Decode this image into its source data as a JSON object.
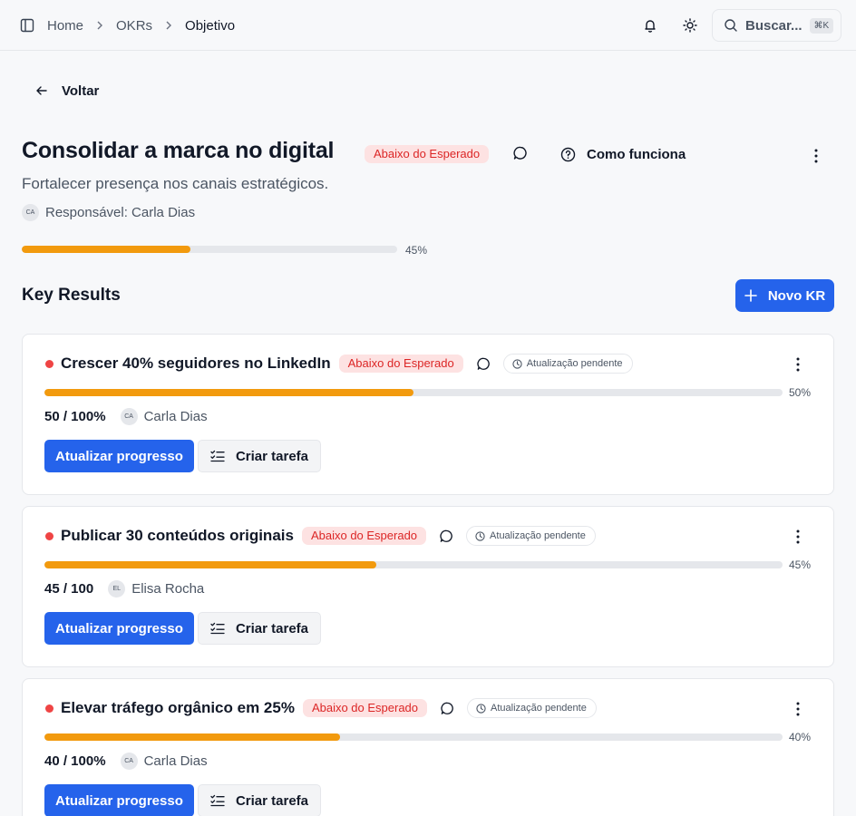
{
  "breadcrumb": {
    "home": "Home",
    "okrs": "OKRs",
    "current": "Objetivo"
  },
  "search": {
    "label": "Buscar...",
    "shortcut": "⌘K"
  },
  "back_label": "Voltar",
  "objective": {
    "title": "Consolidar a marca no digital",
    "status": "Abaixo do Esperado",
    "how_it_works": "Como funciona",
    "subtitle": "Fortalecer presença nos canais estratégicos.",
    "owner_initials": "CA",
    "owner_label": "Responsável: Carla Dias",
    "progress": 45,
    "progress_label": "45%"
  },
  "key_results_heading": "Key Results",
  "new_kr_label": "Novo KR",
  "key_results": [
    {
      "title": "Crescer 40% seguidores no LinkedIn",
      "status": "Abaixo do Esperado",
      "pending_label": "Atualização pendente",
      "progress": 50,
      "progress_label": "50%",
      "value": "50 / 100%",
      "owner_initials": "CA",
      "owner": "Carla Dias",
      "update_label": "Atualizar progresso",
      "task_label": "Criar tarefa"
    },
    {
      "title": "Publicar 30 conteúdos originais",
      "status": "Abaixo do Esperado",
      "pending_label": "Atualização pendente",
      "progress": 45,
      "progress_label": "45%",
      "value": "45 / 100",
      "owner_initials": "EL",
      "owner": "Elisa Rocha",
      "update_label": "Atualizar progresso",
      "task_label": "Criar tarefa"
    },
    {
      "title": "Elevar tráfego orgânico em 25%",
      "status": "Abaixo do Esperado",
      "pending_label": "Atualização pendente",
      "progress": 40,
      "progress_label": "40%",
      "value": "40 / 100%",
      "owner_initials": "CA",
      "owner": "Carla Dias",
      "update_label": "Atualizar progresso",
      "task_label": "Criar tarefa"
    }
  ],
  "colors": {
    "accent": "#2563eb",
    "progress": "#f29a0e",
    "status_danger": "#dc2626",
    "status_danger_bg": "#fde2e2"
  },
  "icons": [
    "sidebar-toggle-icon",
    "chevron-right-icon",
    "bell-icon",
    "sun-icon",
    "search-icon",
    "arrow-left-icon",
    "comment-icon",
    "help-circle-icon",
    "more-vertical-icon",
    "plus-icon",
    "clock-icon",
    "checklist-icon"
  ]
}
